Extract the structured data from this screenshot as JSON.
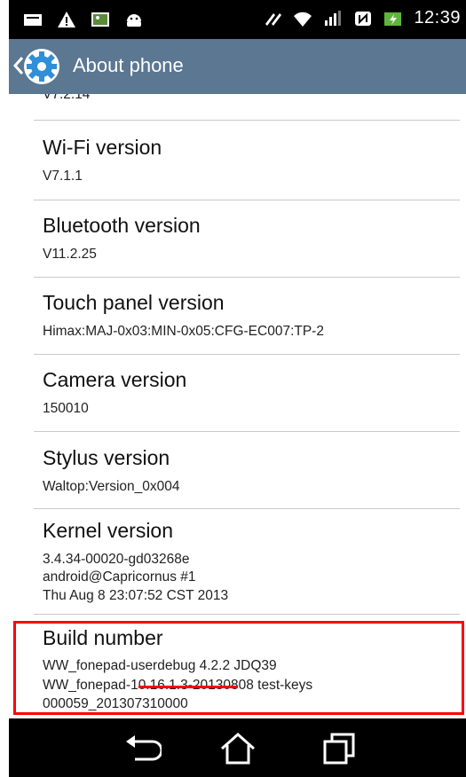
{
  "status_bar": {
    "time": "12:39",
    "left_icons": [
      "mail-icon",
      "warning-icon",
      "image-icon",
      "android-icon"
    ],
    "right_icons": [
      "no-sync-icon",
      "wifi-icon",
      "signal-icon",
      "nfc-icon",
      "battery-charging-icon"
    ]
  },
  "action_bar": {
    "title": "About phone",
    "icon": "settings-gear-icon"
  },
  "list": {
    "partial_top_value": "V7.2.14",
    "items": [
      {
        "title": "Wi-Fi version",
        "lines": [
          "V7.1.1"
        ]
      },
      {
        "title": "Bluetooth version",
        "lines": [
          "V11.2.25"
        ]
      },
      {
        "title": "Touch panel version",
        "lines": [
          "Himax:MAJ-0x03:MIN-0x05:CFG-EC007:TP-2"
        ]
      },
      {
        "title": "Camera version",
        "lines": [
          "150010"
        ]
      },
      {
        "title": "Stylus version",
        "lines": [
          "Waltop:Version_0x004"
        ]
      },
      {
        "title": "Kernel version",
        "lines": [
          "3.4.34-00020-gd03268e",
          "android@Capricornus #1",
          "Thu Aug 8 23:07:52 CST 2013"
        ]
      },
      {
        "title": "Build number",
        "lines": [
          "WW_fonepad-userdebug 4.2.2 JDQ39",
          "WW_fonepad-10.16.1.3-20130808 test-keys",
          "000059_201307310000"
        ]
      }
    ]
  },
  "nav_bar": {
    "buttons": [
      "back-icon",
      "home-icon",
      "recent-apps-icon"
    ]
  },
  "colors": {
    "action_bar": "#5b7791",
    "highlight": "#ff0000"
  }
}
